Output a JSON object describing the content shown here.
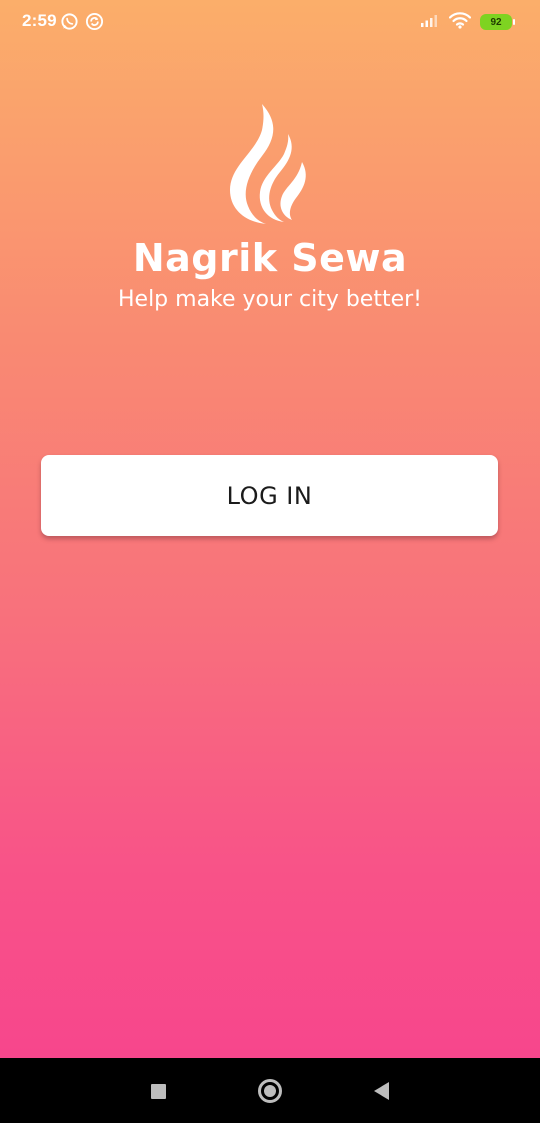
{
  "status_bar": {
    "time": "2:59",
    "battery": "92",
    "icons": [
      "whatsapp-icon",
      "sync-icon",
      "signal-icon",
      "wifi-icon",
      "battery-icon"
    ]
  },
  "app": {
    "logo_icon": "flame-icon",
    "title": "Nagrik Sewa",
    "subtitle": "Help make your city better!"
  },
  "actions": {
    "login_label": "LOG IN"
  },
  "navigation": {
    "recents_icon": "square-icon",
    "home_icon": "circle-icon",
    "back_icon": "back-triangle-icon"
  },
  "colors": {
    "gradient_top": "#FBAE6A",
    "gradient_bottom": "#F7468C",
    "battery_green": "#7ED321"
  }
}
